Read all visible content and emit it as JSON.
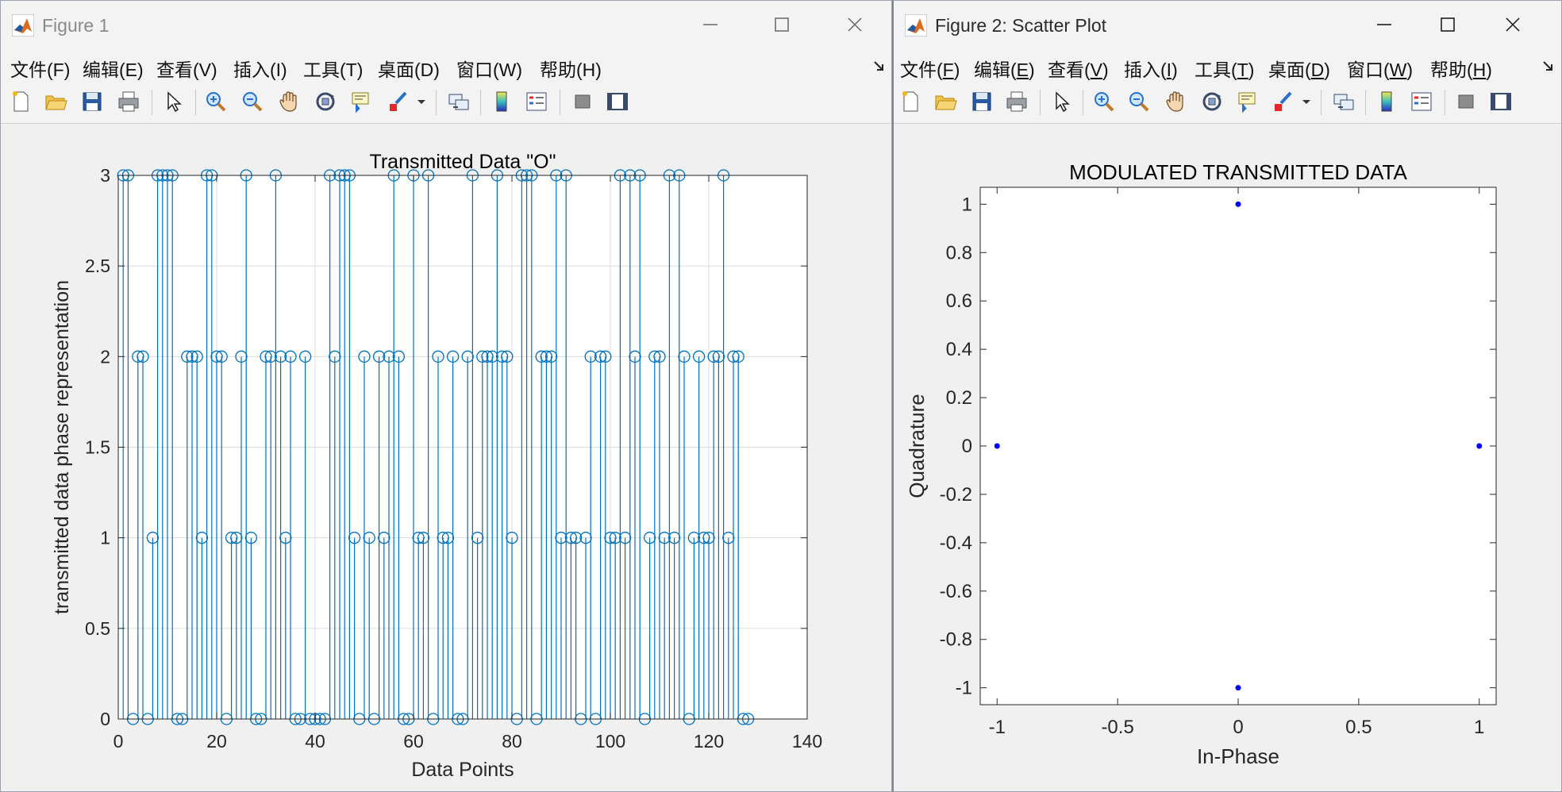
{
  "figure1": {
    "window_title": "Figure 1",
    "menu": [
      "文件(F)",
      "编辑(E)",
      "查看(V)",
      "插入(I)",
      "工具(T)",
      "桌面(D)",
      "窗口(W)",
      "帮助(H)"
    ],
    "chart_data": {
      "type": "stem",
      "title": "Transmitted Data \"O\"",
      "xlabel": "Data Points",
      "ylabel": "transmitted data phase representation",
      "xlim": [
        0,
        140
      ],
      "ylim": [
        0,
        3
      ],
      "xticks": [
        "0",
        "20",
        "40",
        "60",
        "80",
        "100",
        "120",
        "140"
      ],
      "yticks": [
        "0",
        "0.5",
        "1",
        "1.5",
        "2",
        "2.5",
        "3"
      ],
      "grid": true,
      "color": "#0072bd",
      "values": [
        3,
        3,
        0,
        2,
        2,
        0,
        1,
        3,
        3,
        3,
        3,
        0,
        0,
        2,
        2,
        2,
        1,
        3,
        3,
        2,
        2,
        0,
        1,
        1,
        2,
        3,
        1,
        0,
        0,
        2,
        2,
        3,
        2,
        1,
        2,
        0,
        0,
        2,
        0,
        0,
        0,
        0,
        3,
        2,
        3,
        3,
        3,
        1,
        0,
        2,
        1,
        0,
        2,
        1,
        2,
        3,
        2,
        0,
        0,
        3,
        1,
        1,
        3,
        0,
        2,
        1,
        1,
        2,
        0,
        0,
        2,
        3,
        1,
        2,
        2,
        2,
        3,
        2,
        2,
        1,
        0,
        3,
        3,
        3,
        0,
        2,
        2,
        2,
        3,
        1,
        3,
        1,
        1,
        0,
        1,
        2,
        0,
        2,
        2,
        1,
        1,
        3,
        1,
        3,
        2,
        3,
        0,
        1,
        2,
        2,
        1,
        3,
        1,
        3,
        2,
        0,
        1,
        2,
        1,
        1,
        2,
        2,
        3,
        1,
        2,
        2,
        0,
        0
      ]
    }
  },
  "figure2": {
    "window_title": "Figure 2: Scatter Plot",
    "menu": [
      {
        "pre": "文件(",
        "key": "F",
        "post": ")"
      },
      {
        "pre": "编辑(",
        "key": "E",
        "post": ")"
      },
      {
        "pre": "查看(",
        "key": "V",
        "post": ")"
      },
      {
        "pre": "插入(",
        "key": "I",
        "post": ")"
      },
      {
        "pre": "工具(",
        "key": "T",
        "post": ")"
      },
      {
        "pre": "桌面(",
        "key": "D",
        "post": ")"
      },
      {
        "pre": "窗口(",
        "key": "W",
        "post": ")"
      },
      {
        "pre": "帮助(",
        "key": "H",
        "post": ")"
      }
    ],
    "chart_data": {
      "type": "scatter",
      "title": "MODULATED TRANSMITTED DATA",
      "xlabel": "In-Phase",
      "ylabel": "Quadrature",
      "xlim": [
        -1.07,
        1.07
      ],
      "ylim": [
        -1.07,
        1.07
      ],
      "xticks": [
        "-1",
        "-0.5",
        "0",
        "0.5",
        "1"
      ],
      "yticks": [
        "-1",
        "-0.8",
        "-0.6",
        "-0.4",
        "-0.2",
        "0",
        "0.2",
        "0.4",
        "0.6",
        "0.8",
        "1"
      ],
      "grid": false,
      "color": "#0000ff",
      "points": [
        [
          1,
          0
        ],
        [
          0,
          1
        ],
        [
          -1,
          0
        ],
        [
          0,
          -1
        ]
      ]
    }
  }
}
